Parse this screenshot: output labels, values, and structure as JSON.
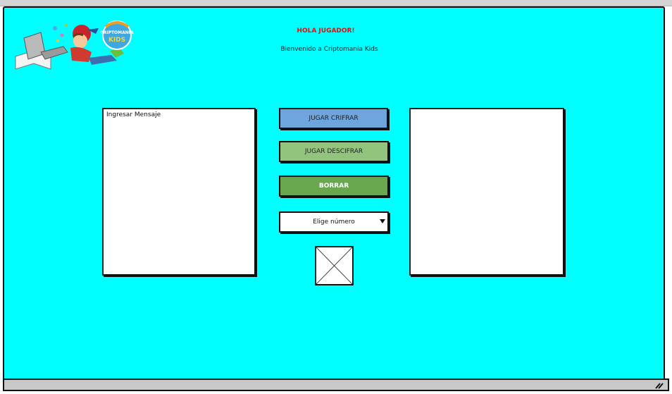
{
  "header": {
    "greeting": "HOLA JUGADOR!",
    "welcome": "Bienvenido a Criptomania Kids"
  },
  "logo": {
    "text_line1": "CRIPTOMANÍA",
    "text_line2": "KIDS"
  },
  "input_panel": {
    "placeholder": "Ingresar Mensaje"
  },
  "output_panel": {},
  "buttons": {
    "cifrar": "JUGAR CRIFRAR",
    "descifrar": "JUGAR DESCIFRAR",
    "borrar": "BORRAR"
  },
  "number_select": {
    "selected": "Elige número"
  },
  "colors": {
    "canvas_bg": "#00ffff",
    "cifrar_bg": "#6fa5dd",
    "descifrar_bg": "#93c47d",
    "borrar_bg": "#6aa84f",
    "greeting": "#e01010"
  },
  "icons": {
    "image_placeholder": "image-placeholder-icon",
    "resize": "resize-grip-icon",
    "dropdown": "caret-down-icon"
  }
}
